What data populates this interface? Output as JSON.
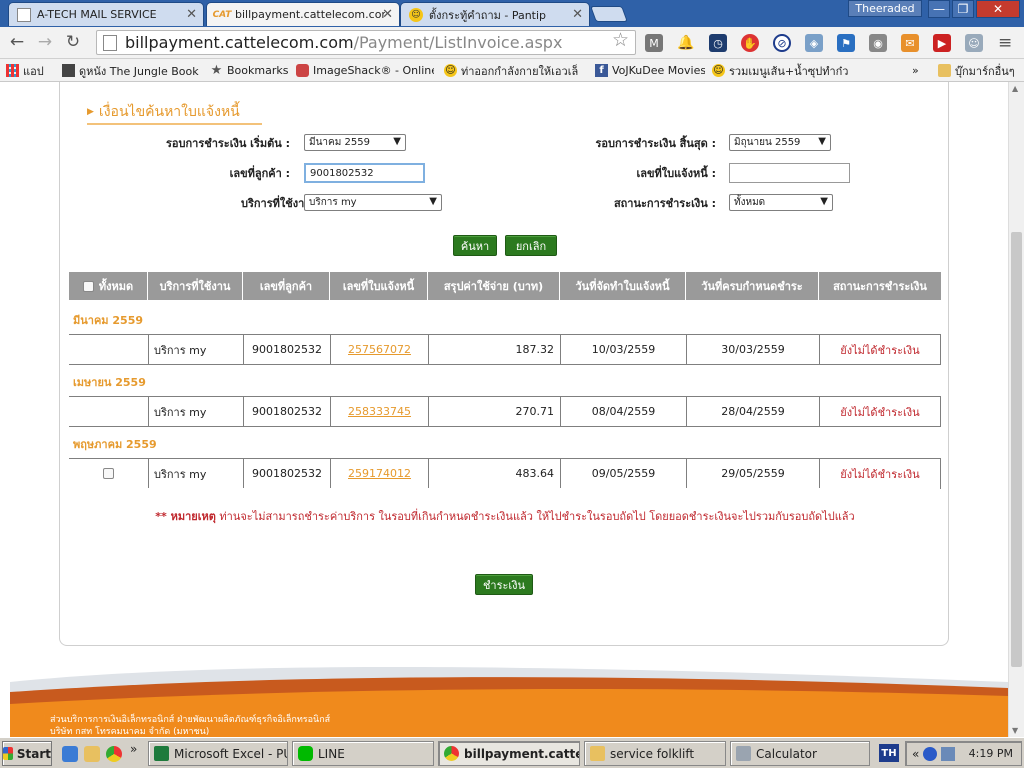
{
  "browser": {
    "tabs": [
      {
        "label": "A-TECH MAIL SERVICE",
        "icon": "page-icon"
      },
      {
        "label": "billpayment.cattelecom.com/",
        "icon": "cat-logo-icon",
        "icon_text": "CAT"
      },
      {
        "label": "ตั้งกระทู้คำถาม - Pantip",
        "icon": "smiley-icon"
      }
    ],
    "user": "Theeraded",
    "window_buttons": {
      "minimize": "—",
      "restore": "❐",
      "close": "✕"
    },
    "url_host": "billpayment.cattelecom.com",
    "url_path": "/Payment/ListInvoice.aspx",
    "nav": {
      "back": "←",
      "forward": "→",
      "reload": "↻",
      "star": "☆",
      "menu": "≡"
    },
    "bookmarks": [
      {
        "label": "แอป",
        "icon": "apps-grid-icon"
      },
      {
        "label": "ดูหนัง The Jungle Book (",
        "icon": "film-icon"
      },
      {
        "label": "Bookmarks",
        "icon": "star-icon"
      },
      {
        "label": "ImageShack® - Online F",
        "icon": "imageshack-icon"
      },
      {
        "label": "ท่าออกกำลังกายให้เอวเล็",
        "icon": "smiley-icon"
      },
      {
        "label": "VoJKuDee Movies",
        "icon": "facebook-icon"
      },
      {
        "label": "รวมเมนูเส้น+น้ำซุปทำก๋ว",
        "icon": "smiley-icon"
      }
    ],
    "bookmarks_more": "»",
    "other_bookmarks": "บุ๊กมาร์กอื่นๆ"
  },
  "search": {
    "section_title": "เงื่อนไขค้นหาใบแจ้งหนี้",
    "start_cycle_label": "รอบการชำระเงิน เริ่มต้น :",
    "start_cycle_value": "มีนาคม 2559",
    "end_cycle_label": "รอบการชำระเงิน สิ้นสุด :",
    "end_cycle_value": "มิถุนายน 2559",
    "customer_no_label": "เลขที่ลูกค้า :",
    "customer_no_value": "9001802532",
    "invoice_no_label": "เลขที่ใบแจ้งหนี้ :",
    "invoice_no_value": "",
    "service_label": "บริการที่ใช้งาน :",
    "service_value": "บริการ my",
    "status_label": "สถานะการชำระเงิน :",
    "status_value": "ทั้งหมด",
    "search_button": "ค้นหา",
    "cancel_button": "ยกเลิก"
  },
  "grid": {
    "headers": [
      "ทั้งหมด",
      "บริการที่ใช้งาน",
      "เลขที่ลูกค้า",
      "เลขที่ใบแจ้งหนี้",
      "สรุปค่าใช้จ่าย (บาท)",
      "วันที่จัดทำใบแจ้งหนี้",
      "วันที่ครบกำหนดชำระ",
      "สถานะการชำระเงิน"
    ],
    "groups": [
      {
        "month": "มีนาคม 2559",
        "rows": [
          {
            "checkbox": false,
            "service": "บริการ my",
            "customer": "9001802532",
            "invoice": "257567072",
            "amount": "187.32",
            "issued": "10/03/2559",
            "due": "30/03/2559",
            "status": "ยังไม่ได้ชำระเงิน"
          }
        ]
      },
      {
        "month": "เมษายน 2559",
        "rows": [
          {
            "checkbox": false,
            "service": "บริการ my",
            "customer": "9001802532",
            "invoice": "258333745",
            "amount": "270.71",
            "issued": "08/04/2559",
            "due": "28/04/2559",
            "status": "ยังไม่ได้ชำระเงิน"
          }
        ]
      },
      {
        "month": "พฤษภาคม 2559",
        "rows": [
          {
            "checkbox": true,
            "service": "บริการ my",
            "customer": "9001802532",
            "invoice": "259174012",
            "amount": "483.64",
            "issued": "09/05/2559",
            "due": "29/05/2559",
            "status": "ยังไม่ได้ชำระเงิน"
          }
        ]
      }
    ]
  },
  "note": {
    "prefix": "** หมายเหตุ",
    "text": " ท่านจะไม่สามารถชำระค่าบริการ ในรอบที่เกินกำหนดชำระเงินแล้ว ให้ไปชำระในรอบถัดไป โดยยอดชำระเงินจะไปรวมกับรอบถัดไปแล้ว"
  },
  "pay_button": "ชำระเงิน",
  "footer": {
    "line1": "ส่วนบริการการเงินอิเล็กทรอนิกส์ ฝ่ายพัฒนาผลิตภัณฑ์ธุรกิจอิเล็กทรอนิกส์",
    "line2": "บริษัท กสท โทรคมนาคม จำกัด (มหาชน)"
  },
  "taskbar": {
    "start": "Start",
    "more": "»",
    "tasks": [
      {
        "label": "Microsoft Excel - PUR...",
        "icon": "excel-icon"
      },
      {
        "label": "LINE",
        "icon": "line-icon"
      },
      {
        "label": "billpayment.cattel...",
        "icon": "chrome-icon"
      },
      {
        "label": "service folklift",
        "icon": "folder-icon"
      },
      {
        "label": "Calculator",
        "icon": "calculator-icon"
      }
    ],
    "lang": "TH",
    "tray_more": "«",
    "clock": "4:19 PM"
  },
  "colors": {
    "accent_orange": "#e69a2e",
    "button_green": "#2c7a1f",
    "status_red": "#c0282e",
    "header_gray": "#9a9a9a"
  }
}
